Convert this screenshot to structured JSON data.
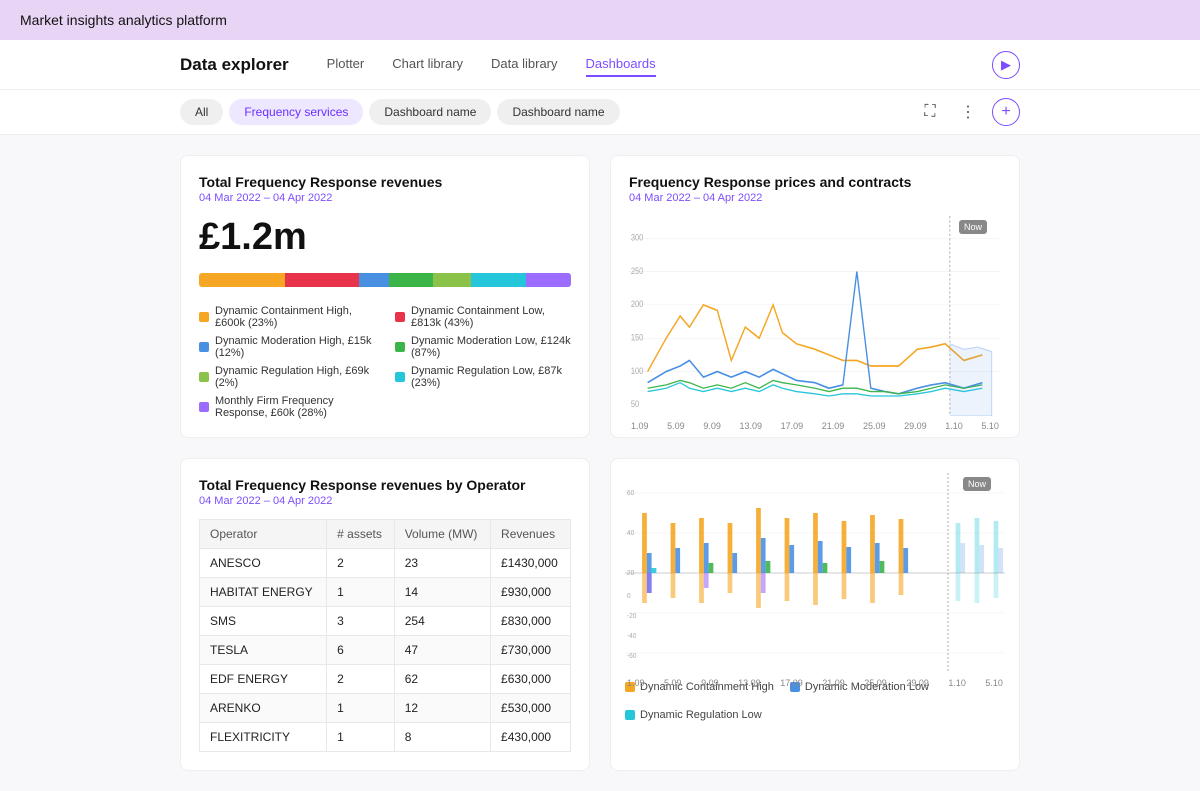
{
  "app": {
    "title": "Market insights analytics platform"
  },
  "nav": {
    "explorer_title": "Data explorer",
    "items": [
      {
        "label": "Plotter",
        "active": false
      },
      {
        "label": "Chart library",
        "active": false
      },
      {
        "label": "Data library",
        "active": false
      },
      {
        "label": "Dashboards",
        "active": true
      }
    ]
  },
  "tabs": {
    "items": [
      {
        "label": "All",
        "active": false
      },
      {
        "label": "Frequency services",
        "active": true
      },
      {
        "label": "Dashboard name",
        "active": false
      },
      {
        "label": "Dashboard name",
        "active": false
      }
    ]
  },
  "panel_left_top": {
    "title": "Total Frequency Response revenues",
    "subtitle": "04 Mar 2022 – 04 Apr 2022",
    "big_number": "£1.2m",
    "legend": [
      {
        "label": "Dynamic Containment High, £600k (23%)",
        "color": "#f5a623"
      },
      {
        "label": "Dynamic Containment Low, £813k (43%)",
        "color": "#e8334a"
      },
      {
        "label": "Dynamic Moderation High, £15k (12%)",
        "color": "#4a90e2"
      },
      {
        "label": "Dynamic Moderation Low, £124k (87%)",
        "color": "#3bb54a"
      },
      {
        "label": "Dynamic Regulation High, £69k (2%)",
        "color": "#8bc34a"
      },
      {
        "label": "Dynamic Regulation Low, £87k (23%)",
        "color": "#26c6da"
      },
      {
        "label": "Monthly Firm Frequency Response, £60k (28%)",
        "color": "#9c6bff"
      }
    ],
    "bar_segments": [
      {
        "color": "#f5a623",
        "width": 23
      },
      {
        "color": "#e8334a",
        "width": 20
      },
      {
        "color": "#4a90e2",
        "width": 8
      },
      {
        "color": "#3bb54a",
        "width": 12
      },
      {
        "color": "#8bc34a",
        "width": 10
      },
      {
        "color": "#26c6da",
        "width": 15
      },
      {
        "color": "#9c6bff",
        "width": 12
      }
    ]
  },
  "panel_right_top": {
    "title": "Frequency Response prices and contracts",
    "subtitle": "04 Mar 2022 – 04 Apr 2022",
    "now_label": "Now",
    "x_labels": [
      "1.09",
      "5.09",
      "9.09",
      "13.09",
      "17.09",
      "21.09",
      "25.09",
      "29.09",
      "1.10",
      "5.10"
    ]
  },
  "panel_bottom_left": {
    "title": "Total Frequency Response revenues by Operator",
    "subtitle": "04 Mar 2022 – 04 Apr 2022",
    "table": {
      "headers": [
        "Operator",
        "# assets",
        "Volume (MW)",
        "Revenues"
      ],
      "rows": [
        [
          "ANESCO",
          "2",
          "23",
          "£1430,000"
        ],
        [
          "HABITAT ENERGY",
          "1",
          "14",
          "£930,000"
        ],
        [
          "SMS",
          "3",
          "254",
          "£830,000"
        ],
        [
          "TESLA",
          "6",
          "47",
          "£730,000"
        ],
        [
          "EDF ENERGY",
          "2",
          "62",
          "£630,000"
        ],
        [
          "ARENKO",
          "1",
          "12",
          "£530,000"
        ],
        [
          "FLEXITRICITY",
          "1",
          "8",
          "£430,000"
        ]
      ]
    }
  },
  "panel_bottom_right": {
    "now_label": "Now",
    "x_labels": [
      "1.09",
      "5.09",
      "9.09",
      "13.09",
      "17.09",
      "21.09",
      "25.09",
      "29.09",
      "1.10",
      "5.10"
    ],
    "legend": [
      {
        "label": "Dynamic Containment High",
        "color": "#f5a623"
      },
      {
        "label": "Dynamic Moderation Low",
        "color": "#4a90e2"
      },
      {
        "label": "Dynamic Regulation Low",
        "color": "#26c6da"
      }
    ],
    "y_labels": [
      "60",
      "40",
      "20",
      "0",
      "-20",
      "-40",
      "-60"
    ]
  }
}
